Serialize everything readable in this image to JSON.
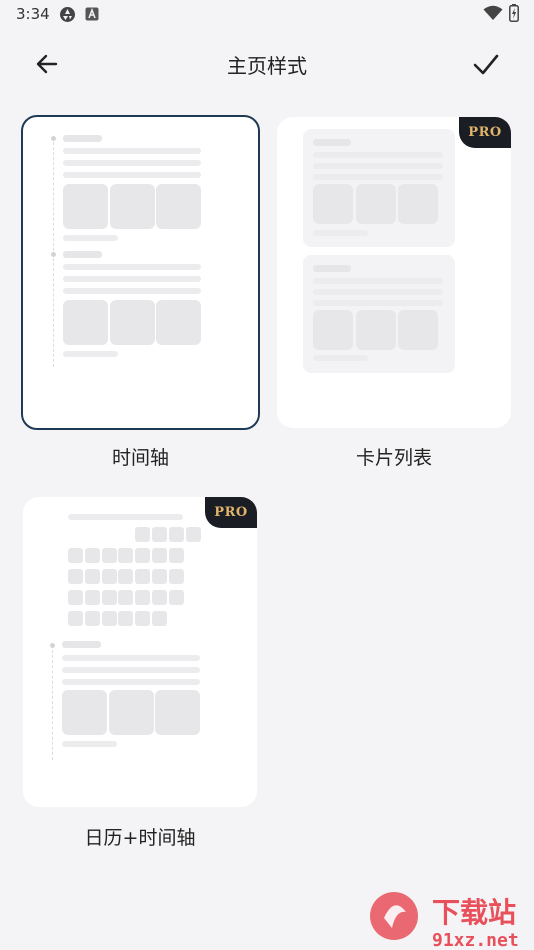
{
  "status": {
    "time": "3:34"
  },
  "header": {
    "title": "主页样式"
  },
  "options": [
    {
      "label": "时间轴",
      "selected": true,
      "pro": ""
    },
    {
      "label": "卡片列表",
      "selected": false,
      "pro": "PRO"
    },
    {
      "label": "日历+时间轴",
      "selected": false,
      "pro": "PRO"
    }
  ],
  "watermark": {
    "brand": "下载站",
    "domain": "91xz.net"
  },
  "colors": {
    "accent": "#1f3a55",
    "background": "#f4f4f6",
    "pro_badge": "#1b1d24",
    "pro_text": "#e0b56b",
    "watermark": "#e8505b"
  }
}
